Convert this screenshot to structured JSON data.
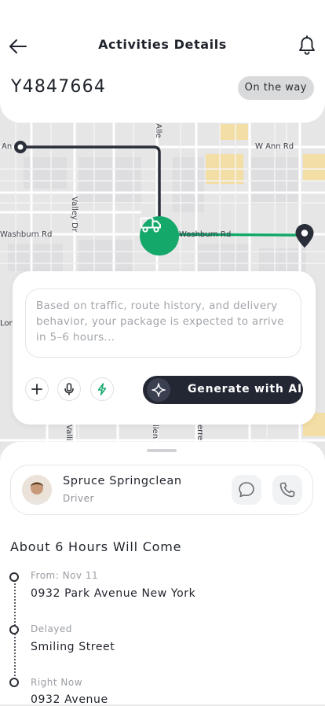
{
  "header": {
    "title": "Activities Details",
    "tracking_id": "Y4847664",
    "status": "On the way"
  },
  "map": {
    "streets": [
      "W Ann Rd",
      "Washburn Rd",
      "Washburn Rd",
      "Valley Dr",
      "Allen",
      "Lon",
      "Valli",
      "llen",
      "erre",
      "An",
      "Alle"
    ]
  },
  "ai_panel": {
    "placeholder": "Based on traffic, route history, and delivery behavior, your package is expected to arrive in 5–6 hours...",
    "generate_label": "Generate with AI"
  },
  "driver": {
    "name": "Spruce Springclean",
    "role": "Driver"
  },
  "eta": {
    "heading": "About 6 Hours Will Come",
    "timeline": [
      {
        "label": "From: Nov 11",
        "value": "0932 Park Avenue New York"
      },
      {
        "label": "Delayed",
        "value": "Smiling Street"
      },
      {
        "label": "Right Now",
        "value": "0932 Avenue"
      }
    ]
  },
  "colors": {
    "accent_green": "#14a86b",
    "dark_button": "#232734",
    "route_dark": "#2a2e38"
  },
  "icons": [
    "back-arrow-icon",
    "bell-icon",
    "truck-icon",
    "location-pin-icon",
    "plus-icon",
    "microphone-icon",
    "lightning-icon",
    "sparkle-icon",
    "chat-icon",
    "phone-icon"
  ]
}
